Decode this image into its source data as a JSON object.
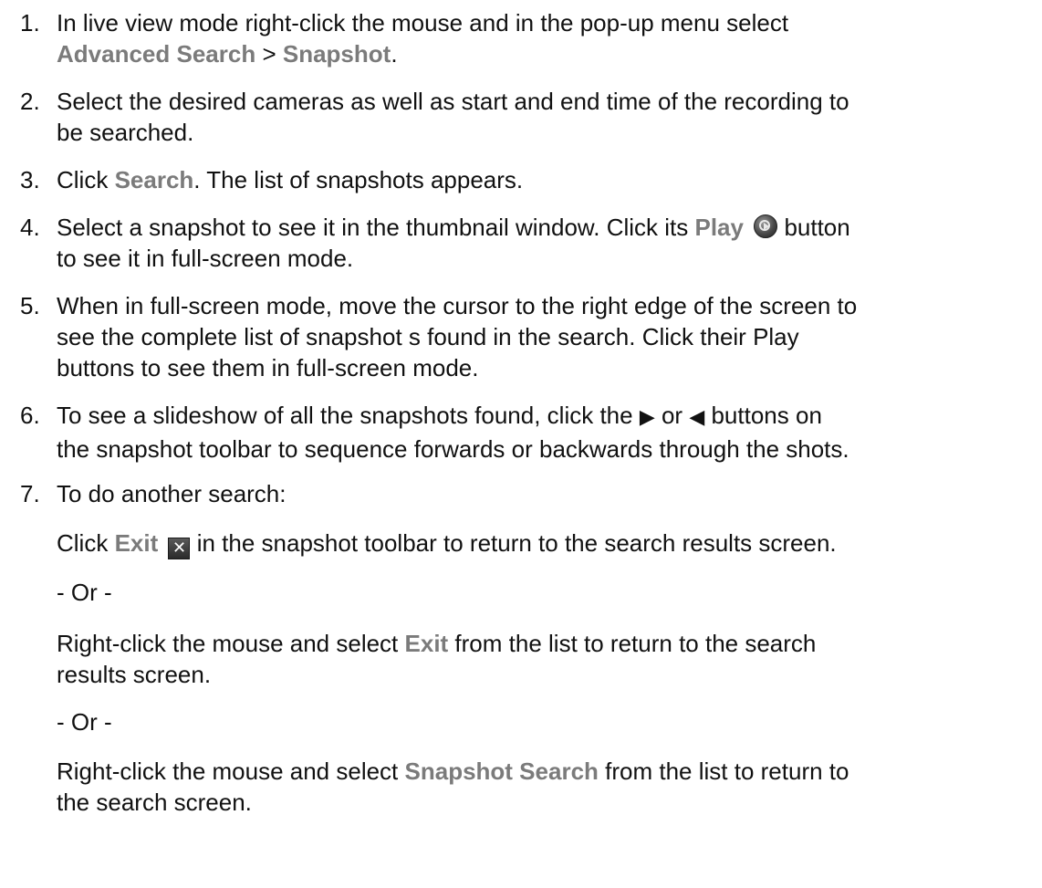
{
  "steps": [
    {
      "num": "1.",
      "t1": "In live view mode right-click the mouse and in the pop-up menu select",
      "ui1": "Advanced Search",
      "t2": " > ",
      "ui2": "Snapshot",
      "t3": "."
    },
    {
      "num": "2.",
      "t1": "Select the desired cameras as well as start and end time of the recording to",
      "t2": "be searched."
    },
    {
      "num": "3.",
      "t1": "Click ",
      "ui1": "Search",
      "t2": ". The list of snapshots appears."
    },
    {
      "num": "4.",
      "t1": "Select a snapshot to see it in the thumbnail window. Click its ",
      "ui1": "Play",
      "t2": " button",
      "t3": "to see it in full-screen mode.",
      "icon": "play-button-icon"
    },
    {
      "num": "5.",
      "t1": "When in full-screen mode, move the cursor to the right edge of the screen to",
      "t2": "see the complete list of snapshot s found in the search. Click their Play",
      "t3": "buttons to see them in full-screen mode."
    },
    {
      "num": "6.",
      "t1": "To see a slideshow of all the snapshots found, click the ",
      "fwd": "▶",
      "t2": " or ",
      "back": "◀",
      "t3": " buttons on",
      "t4": "the snapshot toolbar to sequence forwards or backwards through the shots."
    },
    {
      "num": "7.",
      "t1": "To do another search:"
    }
  ],
  "step7": {
    "p1a": "Click ",
    "p1ui": "Exit",
    "p1b": " in the snapshot toolbar to return to the search results screen.",
    "exit_icon": "exit-close-icon",
    "exit_glyph": "✕",
    "or1": "- Or -",
    "p2a": "Right-click the mouse and select ",
    "p2ui": "Exit",
    "p2b": " from the list to return to the search",
    "p2c": "results screen.",
    "or2": "- Or -",
    "p3a": "Right-click the mouse and select ",
    "p3ui": "Snapshot Search",
    "p3b": " from the list to return to",
    "p3c": "the search screen."
  },
  "colors": {
    "text": "#111111",
    "ui_term": "#7b7b7b"
  }
}
